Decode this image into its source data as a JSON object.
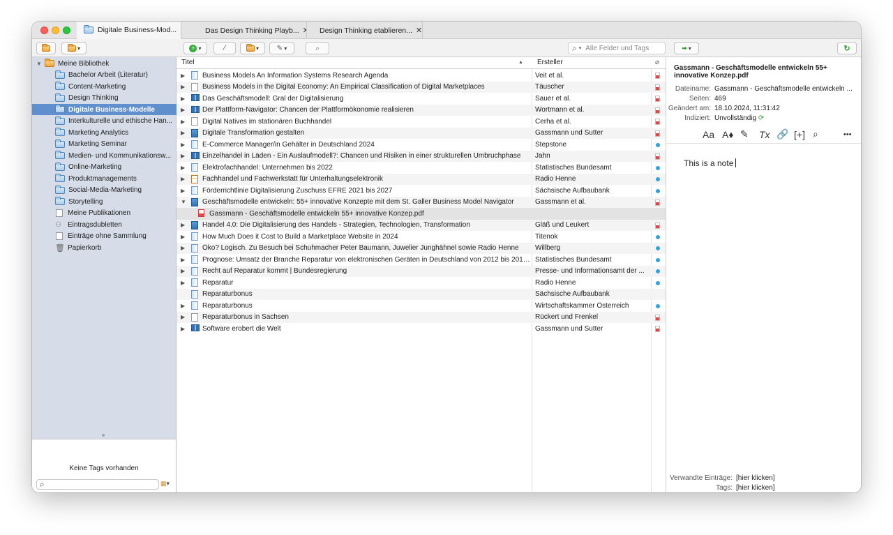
{
  "tabs": [
    {
      "label": "Digitale Business-Mod..."
    },
    {
      "label": "Das Design Thinking Playb..."
    },
    {
      "label": "Design Thinking etablieren..."
    }
  ],
  "search": {
    "placeholder": "Alle Felder und Tags"
  },
  "columns": {
    "title": "Titel",
    "creator": "Ersteller"
  },
  "library": {
    "root": "Meine Bibliothek",
    "collections": [
      "Bachelor Arbeit (Literatur)",
      "Content-Marketing",
      "Design Thinking",
      "Digitale Business-Modelle",
      "Interkulturelle und ethische Han...",
      "Marketing Analytics",
      "Marketing Seminar",
      "Medien- und Kommunikationsw...",
      "Online-Marketing",
      "Produktmanagements",
      "Social-Media-Marketing",
      "Storytelling"
    ],
    "special": [
      "Meine Publikationen",
      "Eintragsdubletten",
      "Einträge ohne Sammlung",
      "Papierkorb"
    ],
    "selected": "Digitale Business-Modelle"
  },
  "tags": {
    "empty_text": "Keine Tags vorhanden"
  },
  "items": [
    {
      "title": "Business Models An Information Systems Research Agenda",
      "creator": "Veit et al.",
      "icon": "journal",
      "att": "pdf"
    },
    {
      "title": "Business Models in the Digital Economy: An Empirical Classification of Digital Marketplaces",
      "creator": "Täuscher",
      "icon": "doc",
      "att": "pdf"
    },
    {
      "title": "Das Geschäftsmodell: Gral der Digitalisierung",
      "creator": "Sauer et al.",
      "icon": "book",
      "att": "pdf"
    },
    {
      "title": "Der Plattform-Navigator: Chancen der Plattformökonomie realisieren",
      "creator": "Wortmann et al.",
      "icon": "book",
      "att": "pdf"
    },
    {
      "title": "Digital Natives im stationären Buchhandel",
      "creator": "Cerha et al.",
      "icon": "doc",
      "att": "pdf"
    },
    {
      "title": "Digitale Transformation gestalten",
      "creator": "Gassmann und Sutter",
      "icon": "blue",
      "att": "pdf"
    },
    {
      "title": "E-Commerce Manager/in Gehälter in Deutschland 2024",
      "creator": "Stepstone",
      "icon": "journal",
      "att": "dot"
    },
    {
      "title": "Einzelhandel in Läden - Ein Auslaufmodell?: Chancen und Risiken in einer strukturellen Umbruchphase",
      "creator": "Jahn",
      "icon": "book",
      "att": "pdf"
    },
    {
      "title": "Elektrofachhandel: Unternehmen bis 2022",
      "creator": "Statistisches Bundesamt",
      "icon": "journal",
      "att": "dot"
    },
    {
      "title": "Fachhandel und Fachwerkstatt für Unterhaltungselektronik",
      "creator": "Radio Henne",
      "icon": "report",
      "att": "dot"
    },
    {
      "title": "Förderrichtlinie Digitalisierung Zuschuss EFRE 2021 bis 2027",
      "creator": "Sächsische Aufbaubank",
      "icon": "journal",
      "att": "dot"
    },
    {
      "title": "Geschäftsmodelle entwickeln: 55+ innovative Konzepte mit dem St. Galler Business Model Navigator",
      "creator": "Gassmann et al.",
      "icon": "blue",
      "att": "pdf",
      "expanded": true
    },
    {
      "title": "Gassmann - Geschäftsmodelle entwickeln 55+ innovative Konzep.pdf",
      "creator": "",
      "icon": "pdf",
      "att": "",
      "child": true
    },
    {
      "title": "Handel 4.0: Die Digitalisierung des Handels - Strategien, Technologien, Transformation",
      "creator": "Gläß und Leukert",
      "icon": "blue",
      "att": "pdf"
    },
    {
      "title": "How Much Does it Cost to Build a Marketplace Website in 2024",
      "creator": "Titenok",
      "icon": "journal",
      "att": "dot"
    },
    {
      "title": "Öko? Logisch. Zu Besuch bei Schuhmacher Peter Baumann, Juwelier Junghähnel sowie Radio Henne",
      "creator": "Willberg",
      "icon": "journal",
      "att": "dot"
    },
    {
      "title": "Prognose: Umsatz der Branche Reparatur von elektronischen Geräten in Deutschland von 2012 bis 2019...",
      "creator": "Statistisches Bundesamt",
      "icon": "journal",
      "att": "dot"
    },
    {
      "title": "Recht auf Reparatur kommt | Bundesregierung",
      "creator": "Presse- und Informationsamt der ...",
      "icon": "journal",
      "att": "dot"
    },
    {
      "title": "Reparatur",
      "creator": "Radio Henne",
      "icon": "journal",
      "att": "dot"
    },
    {
      "title": "Reparaturbonus",
      "creator": "Sächsische Aufbaubank",
      "icon": "journal",
      "att": "",
      "no_tri": true
    },
    {
      "title": "Reparaturbonus",
      "creator": "Wirtschaftskammer Österreich",
      "icon": "journal",
      "att": "dot"
    },
    {
      "title": "Reparaturbonus in Sachsen",
      "creator": "Rückert und Frenkel",
      "icon": "doc",
      "att": "pdf"
    },
    {
      "title": "Software erobert die Welt",
      "creator": "Gassmann und Sutter",
      "icon": "book",
      "att": "pdf"
    }
  ],
  "attachment": {
    "title": "Gassmann - Geschäftsmodelle entwickeln 55+ innovative Konzep.pdf",
    "filename_label": "Dateiname:",
    "filename": "Gassmann - Geschäftsmodelle entwickeln ...",
    "pages_label": "Seiten:",
    "pages": "469",
    "modified_label": "Geändert am:",
    "modified": "18.10.2024, 11:31:42",
    "indexed_label": "Indiziert:",
    "indexed": "Unvollständig"
  },
  "note_toolbar": {
    "font": "Aa",
    "size": "A♦",
    "clear": "Tx",
    "insert": "[+]",
    "more": "•••"
  },
  "note": {
    "text": "This is a note"
  },
  "related": {
    "related_label": "Verwandte Einträge:",
    "related_value": "[hier klicken]",
    "tags_label": "Tags:",
    "tags_value": "[hier klicken]"
  }
}
